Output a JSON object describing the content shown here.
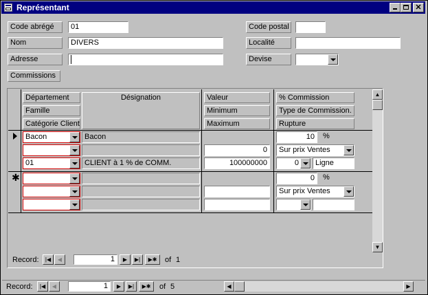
{
  "window": {
    "title": "Représentant"
  },
  "header": {
    "code_label": "Code abrégé",
    "code_value": "01",
    "nom_label": "Nom",
    "nom_value": "DIVERS",
    "adresse_label": "Adresse",
    "adresse_value": "",
    "commissions_label": "Commissions",
    "code_postal_label": "Code postal",
    "code_postal_value": "",
    "localite_label": "Localité",
    "localite_value": "",
    "devise_label": "Devise",
    "devise_value": ""
  },
  "subform": {
    "headers": {
      "departement": "Département",
      "famille": "Famille",
      "categorie": "Catégorie Client",
      "designation": "Désignation",
      "valeur": "Valeur",
      "minimum": "Minimum",
      "maximum": "Maximum",
      "commission": "% Commission",
      "type": "Type de Commission.",
      "rupture": "Rupture"
    },
    "record1": {
      "departement": "Bacon",
      "famille": "",
      "categorie": "01",
      "designation1": "Bacon",
      "designation2": "",
      "designation3": "CLIENT à 1 % de COMM.",
      "minimum": "0",
      "maximum": "100000000",
      "commission": "10",
      "pct": "%",
      "type": "Sur prix Ventes",
      "rupture_num": "0",
      "rupture_text": "Ligne"
    },
    "record2": {
      "departement": "",
      "famille": "",
      "categorie": "",
      "minimum": "",
      "maximum": "",
      "commission": "0",
      "pct": "%",
      "type": "Sur prix Ventes",
      "rupture_num": "",
      "rupture_text": ""
    },
    "nav": {
      "record_label": "Record:",
      "current": "1",
      "of": "of",
      "total": "1"
    }
  },
  "mainnav": {
    "record_label": "Record:",
    "current": "1",
    "of": "of",
    "total": "5"
  }
}
